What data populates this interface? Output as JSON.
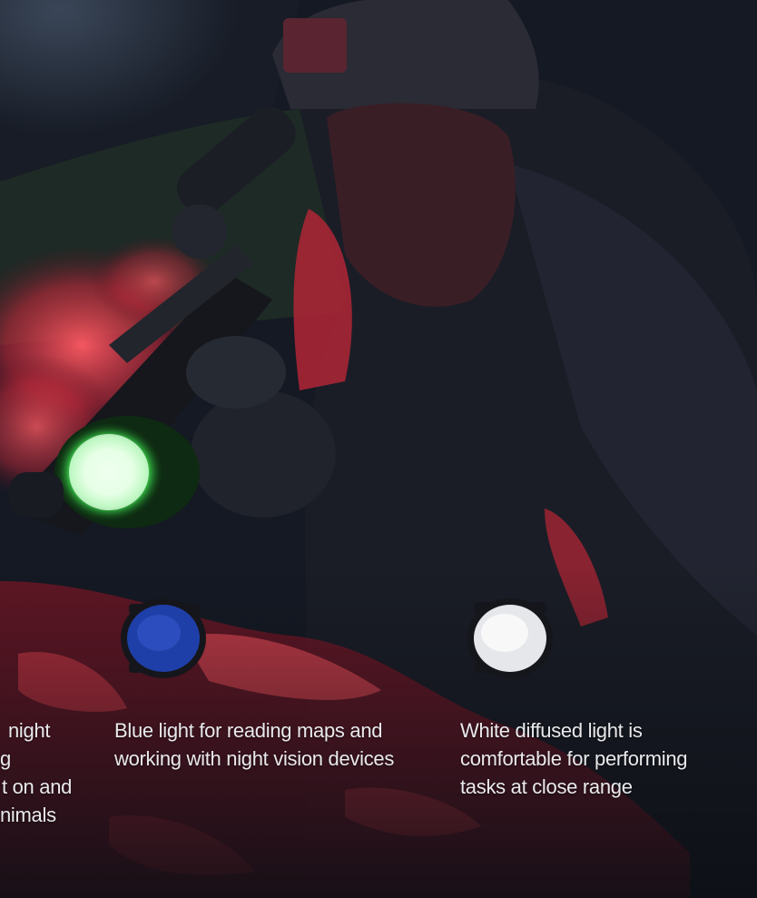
{
  "captions": {
    "red_partial": [
      "night",
      "g",
      "t on and",
      "nimals"
    ],
    "blue": [
      "Blue light for reading maps and",
      "working with night vision devices"
    ],
    "white": [
      "White diffused light is",
      "comfortable for performing",
      "tasks at close range"
    ]
  },
  "filters": {
    "blue": {
      "color": "#1f3fa8"
    },
    "white": {
      "color": "#e6e7ea"
    }
  },
  "flashlight": {
    "glow_color": "#33e04a"
  }
}
